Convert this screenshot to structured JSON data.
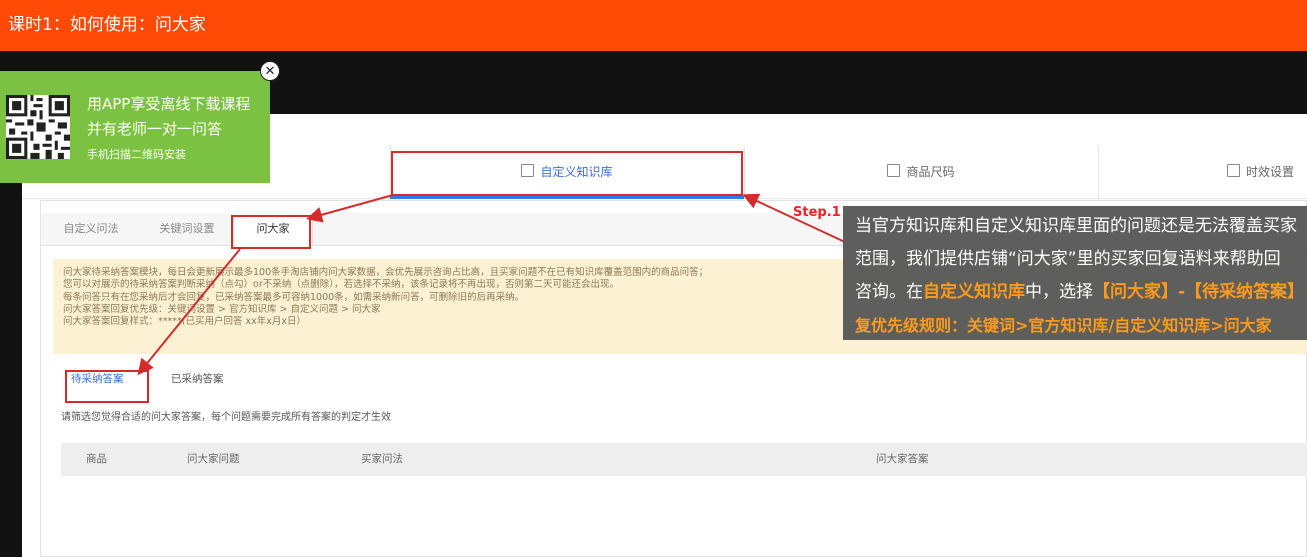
{
  "header": {
    "title": "课时1：如何使用：问大家"
  },
  "promo": {
    "line1": "用APP享受离线下载课程",
    "line2": "并有老师一对一问答",
    "line3": "手机扫描二维码安装",
    "close_glyph": "✕"
  },
  "top_tabs": {
    "tab1": "自定义知识库",
    "tab2": "商品尺码",
    "tab3": "时效设置"
  },
  "sub_tabs": [
    "自定义问法",
    "关键词设置",
    "问大家"
  ],
  "notice_lines": [
    "问大家待采纳答案模块，每日会更新展示最多100条手淘店铺内问大家数据，会优先展示咨询占比高，且买家问题不在已有知识库覆盖范围内的商品问答；",
    "您可以对展示的待采纳答案判断采纳（点勾）or不采纳（点删除），若选择不采纳，该条记录将不再出现，否则第二天可能还会出现。",
    "每条问答只有在您采纳后才会回复，已采纳答案最多可容纳1000条，如需采纳新问答，可删除旧的后再采纳。",
    "问大家答案回复优先级：关键词设置 > 官方知识库 > 自定义问题 > 问大家",
    "问大家答案回复样式：*****(已买用户回答 xx年x月x日）"
  ],
  "answer_tabs": {
    "pending": "待采纳答案",
    "adopted": "已采纳答案"
  },
  "hint": "请筛选您觉得合适的问大家答案，每个问题需要完成所有答案的判定才生效",
  "table_headers": [
    "商品",
    "问大家问题",
    "买家问法",
    "问大家答案"
  ],
  "annotation": {
    "step": "Step.1",
    "line1": "当官方知识库和自定义知识库里面的问题还是无法覆盖买家",
    "line2": "范围，我们提供店铺“问大家”里的买家回复语料来帮助回",
    "line3_a": "咨询。在",
    "line3_b": "自定义知识库",
    "line3_c": "中，选择",
    "line3_d": "【问大家】-【待采纳答案】",
    "line4": "复优先级规则：关键词>官方知识库/自定义知识库>问大家"
  },
  "colors": {
    "header_bg": "#ff4a05",
    "promo_bg": "#7cc242",
    "annotation_red": "#d42b2b",
    "highlight_orange": "#ff9a1a",
    "link_blue": "#3a6fd8",
    "notice_bg": "#fdf1d4"
  }
}
